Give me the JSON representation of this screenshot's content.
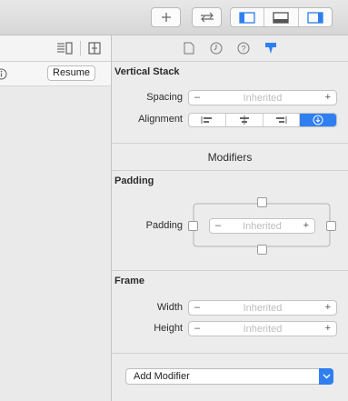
{
  "toolbar": {
    "add_icon": "plus-icon",
    "swap_icon": "swap-arrows-icon",
    "layout_icons": [
      "left-panel-icon",
      "bottom-panel-icon",
      "right-panel-icon"
    ]
  },
  "navigator": {
    "resume_label": "Resume"
  },
  "inspector": {
    "tabs": [
      "file-icon",
      "clock-icon",
      "help-icon",
      "attributes-icon"
    ],
    "vertical_stack": {
      "title": "Vertical Stack",
      "spacing_label": "Spacing",
      "spacing_value": "Inherited",
      "alignment_label": "Alignment",
      "alignment_options": [
        "leading",
        "center",
        "trailing",
        "default"
      ],
      "alignment_selected": 3
    },
    "modifiers_title": "Modifiers",
    "padding": {
      "title": "Padding",
      "label": "Padding",
      "value": "Inherited"
    },
    "frame": {
      "title": "Frame",
      "width_label": "Width",
      "width_value": "Inherited",
      "height_label": "Height",
      "height_value": "Inherited"
    },
    "add_modifier_label": "Add Modifier"
  },
  "colors": {
    "accent": "#2f7ff1"
  }
}
